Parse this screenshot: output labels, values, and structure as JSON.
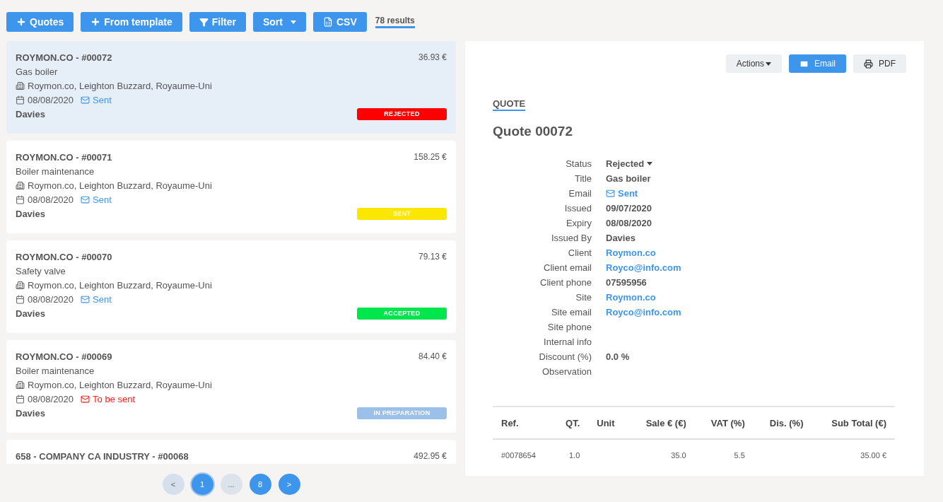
{
  "toolbar": {
    "buttons": [
      {
        "label": "Quotes",
        "kind": "add"
      },
      {
        "label": "From template",
        "kind": "add"
      },
      {
        "label": "Filter",
        "kind": "filter"
      },
      {
        "label": "Sort",
        "kind": "dropdown"
      },
      {
        "label": "CSV",
        "kind": "export"
      }
    ],
    "results": "78 results"
  },
  "quotes": [
    {
      "title": "ROYMON.CO - #00072",
      "amount": "36.93 €",
      "selected": true,
      "subject": "Gas boiler",
      "address": "Roymon.co, Leighton Buzzard, Royaume-Uni",
      "date": "08/08/2020",
      "email_status": {
        "label": "Sent",
        "color": "#3d95ec"
      },
      "author": "Davies",
      "status": {
        "label": "REJECTED",
        "color": "#ff0000"
      }
    },
    {
      "title": "ROYMON.CO - #00071",
      "amount": "158.25 €",
      "selected": false,
      "subject": "Boiler maintenance",
      "address": "Roymon.co, Leighton Buzzard, Royaume-Uni",
      "date": "08/08/2020",
      "email_status": {
        "label": "Sent",
        "color": "#3d95ec"
      },
      "author": "Davies",
      "status": {
        "label": "SENT",
        "color": "#fde600"
      }
    },
    {
      "title": "ROYMON.CO - #00070",
      "amount": "79.13 €",
      "selected": false,
      "subject": "Safety valve",
      "address": "Roymon.co, Leighton Buzzard, Royaume-Uni",
      "date": "08/08/2020",
      "email_status": {
        "label": "Sent",
        "color": "#3d95ec"
      },
      "author": "Davies",
      "status": {
        "label": "ACCEPTED",
        "color": "#00e64d"
      }
    },
    {
      "title": "ROYMON.CO - #00069",
      "amount": "84.40 €",
      "selected": false,
      "subject": "Boiler maintenance",
      "address": "Roymon.co, Leighton Buzzard, Royaume-Uni",
      "date": "08/08/2020",
      "email_status": {
        "label": "To be sent",
        "color": "#ff1a1a"
      },
      "author": "Davies",
      "status": {
        "label": "IN PREPARATION",
        "color": "#9bc0ea"
      }
    },
    {
      "title": "658 - COMPANY CA INDUSTRY - #00068",
      "amount": "492.95 €",
      "selected": false
    }
  ],
  "pagination": [
    {
      "label": "<",
      "kind": "nav",
      "selected": false
    },
    {
      "label": "1",
      "kind": "page",
      "selected": true
    },
    {
      "label": "...",
      "kind": "gap",
      "selected": false
    },
    {
      "label": "8",
      "kind": "page",
      "selected": false
    },
    {
      "label": ">",
      "kind": "nav",
      "selected": false
    }
  ],
  "detail": {
    "actions": [
      {
        "label": "Actions",
        "kind": "dropdown"
      },
      {
        "label": "Email",
        "kind": "email"
      },
      {
        "label": "PDF",
        "kind": "print"
      }
    ],
    "tab": "QUOTE",
    "title": "Quote 00072",
    "fields": [
      {
        "label": "Status",
        "value": "Rejected",
        "kind": "dropdown"
      },
      {
        "label": "Title",
        "value": "Gas boiler",
        "kind": "text"
      },
      {
        "label": "Email",
        "value": "Sent",
        "kind": "email"
      },
      {
        "label": "Issued",
        "value": "09/07/2020",
        "kind": "text"
      },
      {
        "label": "Expiry",
        "value": "08/08/2020",
        "kind": "text"
      },
      {
        "label": "Issued By",
        "value": "Davies",
        "kind": "text"
      },
      {
        "label": "Client",
        "value": "Roymon.co",
        "kind": "link"
      },
      {
        "label": "Client email",
        "value": "Royco@info.com",
        "kind": "link"
      },
      {
        "label": "Client phone",
        "value": "07595956",
        "kind": "text"
      },
      {
        "label": "Site",
        "value": "Roymon.co",
        "kind": "link"
      },
      {
        "label": "Site email",
        "value": "Royco@info.com",
        "kind": "link"
      },
      {
        "label": "Site phone"
      },
      {
        "label": "Internal info"
      },
      {
        "label": "Discount (%)",
        "value": "0.0 %",
        "kind": "text"
      },
      {
        "label": "Observation"
      }
    ],
    "table": {
      "columns": [
        "Ref.",
        "QT.",
        "Unit",
        "Sale € (€)",
        "VAT (%)",
        "Dis. (%)",
        "Sub Total (€)"
      ],
      "rows": [
        [
          "#0078654",
          "1.0",
          "",
          "35.0",
          "5.5",
          "",
          "35.00 €"
        ]
      ]
    }
  }
}
